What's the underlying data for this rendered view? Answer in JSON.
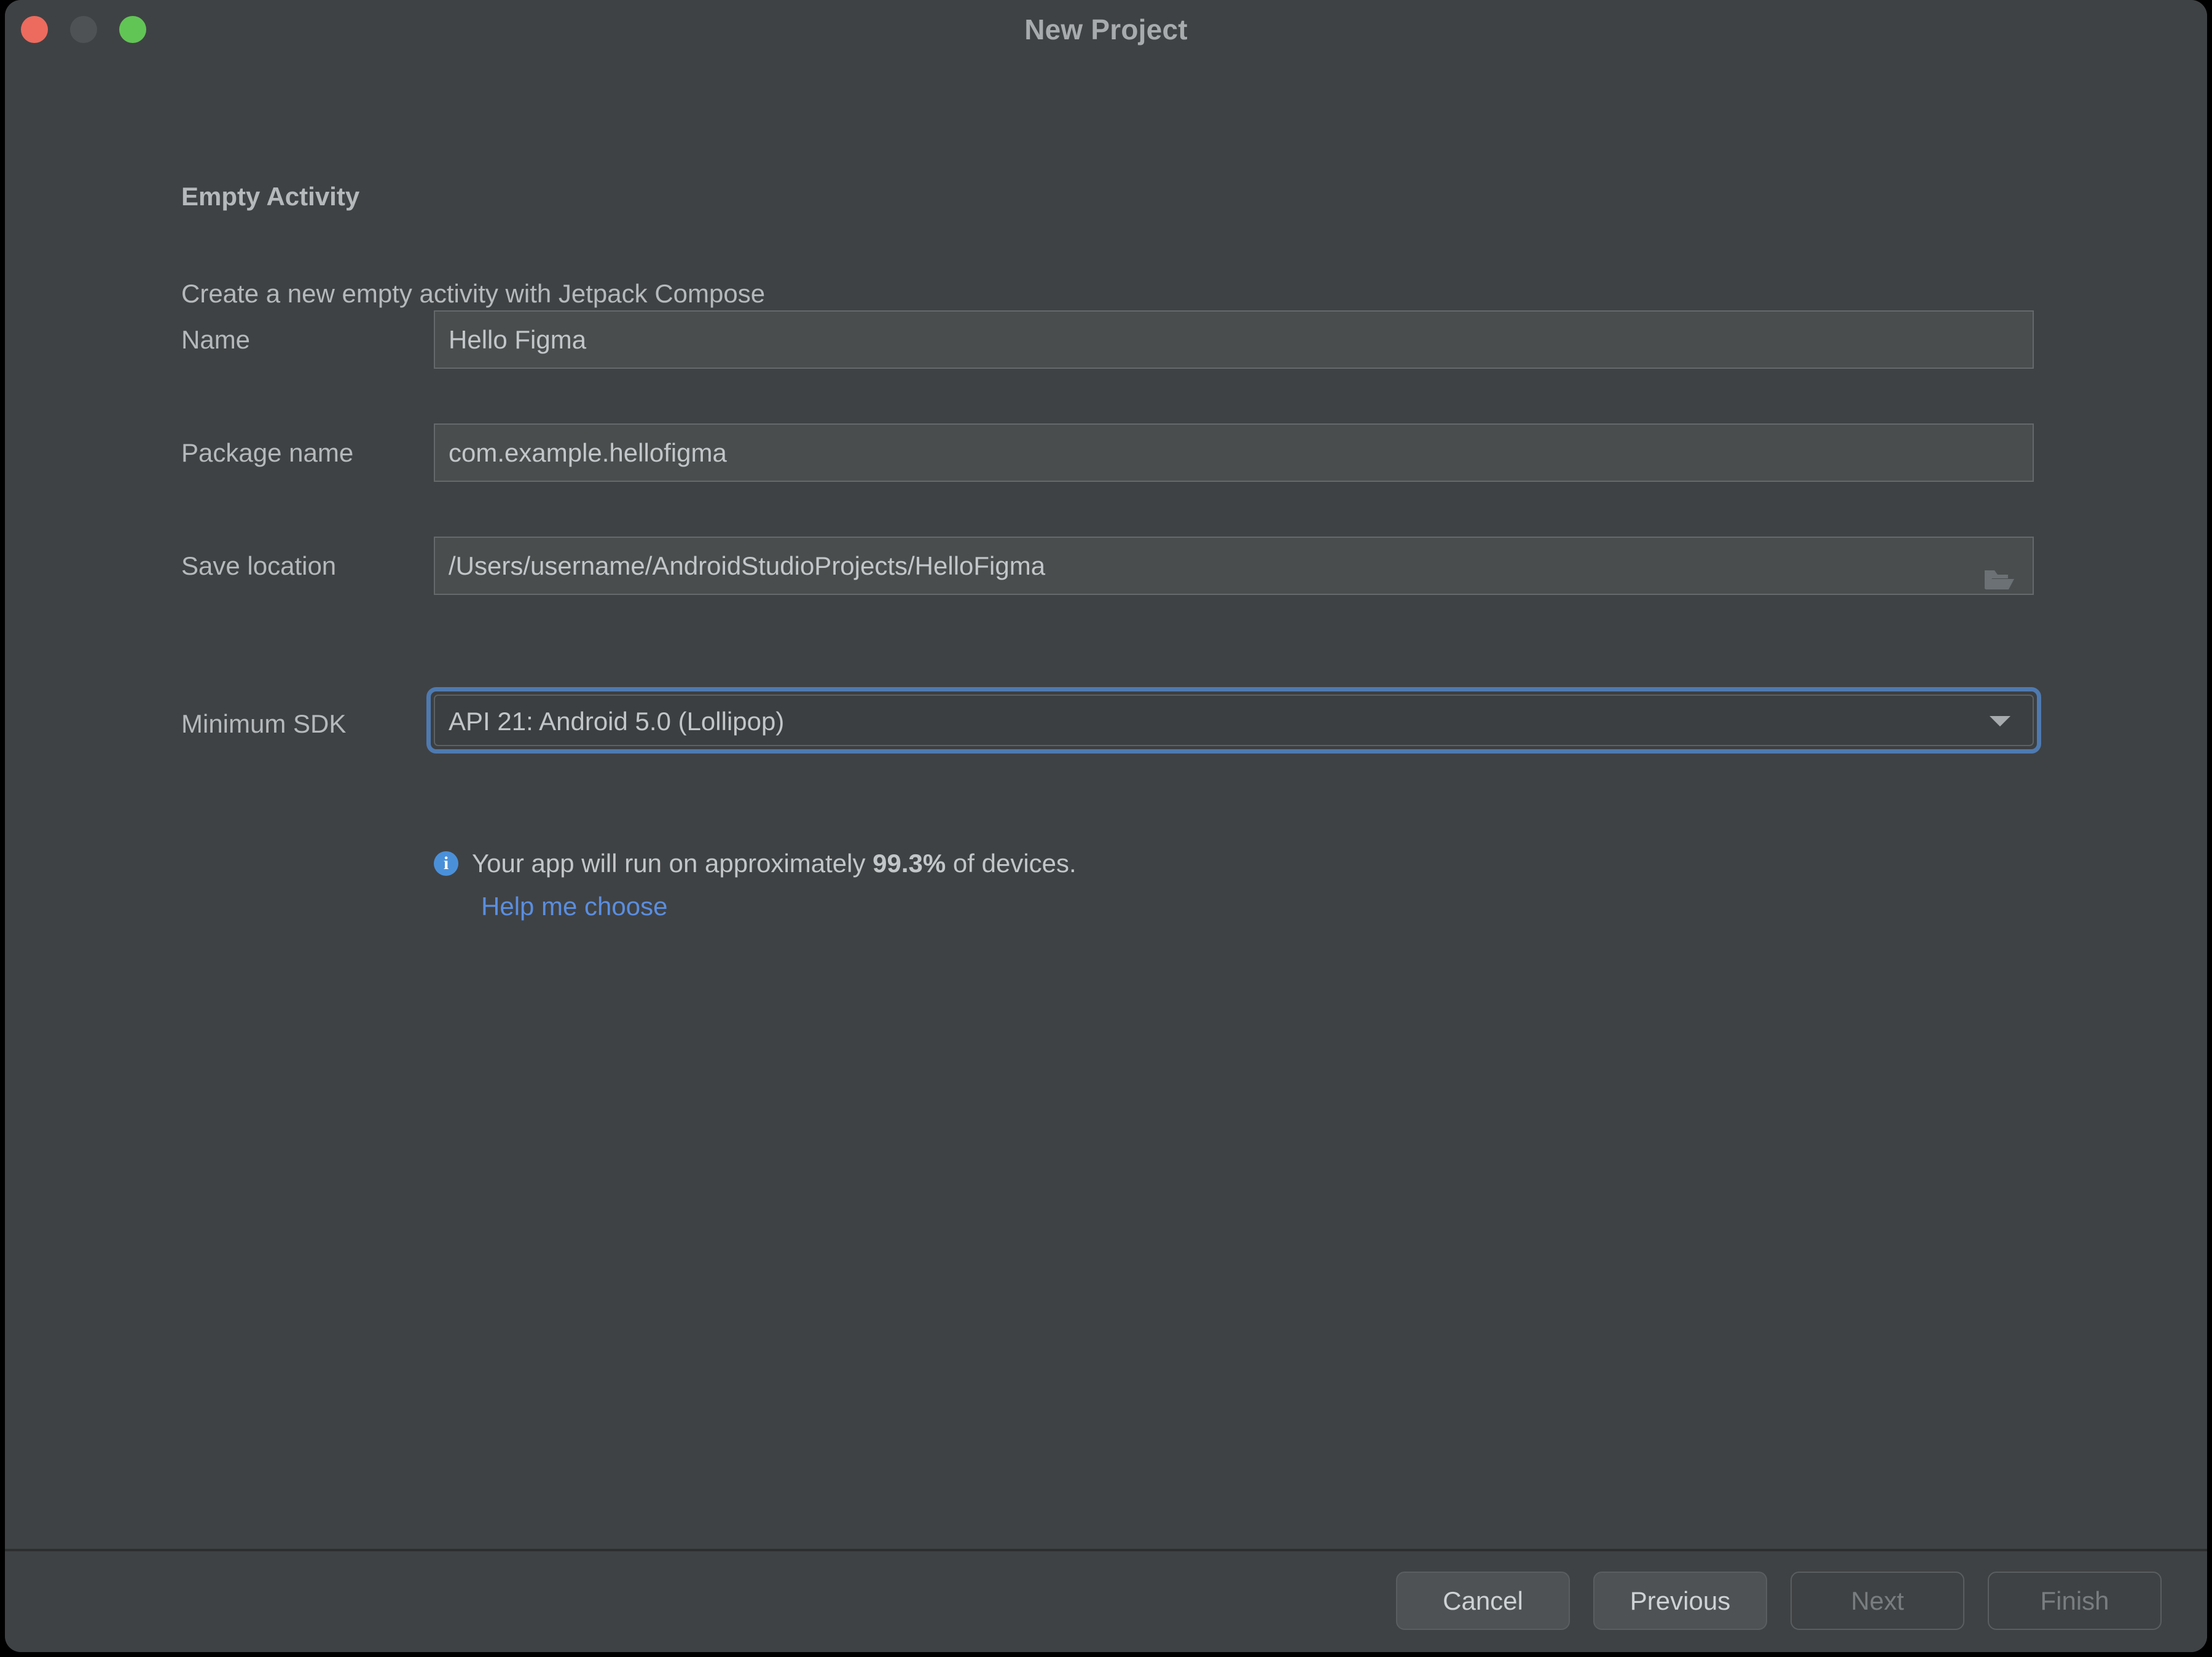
{
  "window": {
    "title": "New Project",
    "traffic_lights": [
      {
        "name": "close",
        "color": "#ed6a5e"
      },
      {
        "name": "minimize",
        "color": "#4f5254"
      },
      {
        "name": "zoom",
        "color": "#61c555"
      }
    ]
  },
  "template": {
    "title": "Empty Activity",
    "subtitle": "Create a new empty activity with Jetpack Compose"
  },
  "form": {
    "name": {
      "label": "Name",
      "value": "Hello Figma",
      "placeholder": "Name"
    },
    "package_name": {
      "label": "Package name",
      "value": "com.example.hellofigma",
      "placeholder": "Package name"
    },
    "save_location": {
      "label": "Save location",
      "value": "/Users/username/AndroidStudioProjects/HelloFigma",
      "placeholder": "Save location",
      "browse_icon": "folder-icon"
    },
    "minimum_sdk": {
      "label": "Minimum SDK",
      "selected": "API 21: Android 5.0 (Lollipop)",
      "arrow_icon": "chevron-down-icon",
      "focused": true,
      "focus_color": "#4e7ab0"
    }
  },
  "info": {
    "icon": "info-icon",
    "icon_color": "#4a90d9",
    "icon_glyph": "i",
    "text_before": "Your app will run on approximately ",
    "percent": "99.3%",
    "text_after": " of devices.",
    "help_link": "Help me choose",
    "link_color": "#5a8ee0"
  },
  "footer": {
    "buttons": [
      {
        "label": "Cancel",
        "state": "enabled"
      },
      {
        "label": "Previous",
        "state": "enabled"
      },
      {
        "label": "Next",
        "state": "disabled"
      },
      {
        "label": "Finish",
        "state": "disabled"
      }
    ]
  }
}
